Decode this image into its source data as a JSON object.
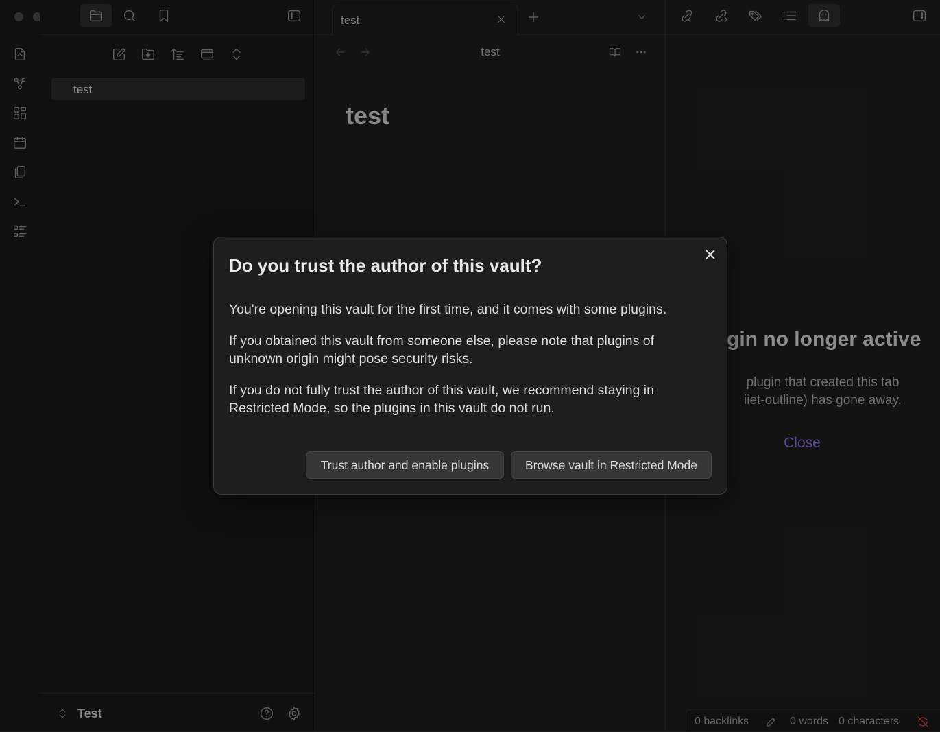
{
  "vault": {
    "name": "Test"
  },
  "files": [
    {
      "name": "test"
    }
  ],
  "tab": {
    "title": "test"
  },
  "editor": {
    "view_title": "test",
    "note_title": "test"
  },
  "right_panel": {
    "message_title": "gin no longer active",
    "message_line1": "plugin that created this tab",
    "message_line2": "iiet-outline) has gone away.",
    "close_label": "Close"
  },
  "status_bar": {
    "backlinks": "0 backlinks",
    "words": "0 words",
    "characters": "0 characters"
  },
  "modal": {
    "title": "Do you trust the author of this vault?",
    "paragraph1": "You're opening this vault for the first time, and it comes with some plugins.",
    "paragraph2": "If you obtained this vault from someone else, please note that plugins of unknown origin might pose security risks.",
    "paragraph3": "If you do not fully trust the author of this vault, we recommend staying in Restricted Mode, so the plugins in this vault do not run.",
    "trust_button": "Trust author and enable plugins",
    "restricted_button": "Browse vault in Restricted Mode"
  },
  "colors": {
    "accent": "#8a6fe0",
    "sync_error": "#e04848",
    "background": "#1e1e1e"
  },
  "icons": {
    "ribbon": [
      "open-quick-switcher-icon",
      "graph-view-icon",
      "canvas-icon",
      "daily-note-icon",
      "templates-icon",
      "command-palette-icon",
      "outline-icon"
    ],
    "file_explorer_toolbar": [
      "new-note-icon",
      "new-folder-icon",
      "sort-icon",
      "auto-reveal-icon",
      "collapse-all-icon"
    ],
    "top_left": [
      "files-icon",
      "search-icon",
      "bookmark-icon",
      "sidebar-toggle-icon"
    ],
    "right_top": [
      "backlinks-icon",
      "outgoing-links-icon",
      "tags-icon",
      "outline-list-icon",
      "ghost-icon",
      "right-sidebar-toggle-icon"
    ]
  }
}
